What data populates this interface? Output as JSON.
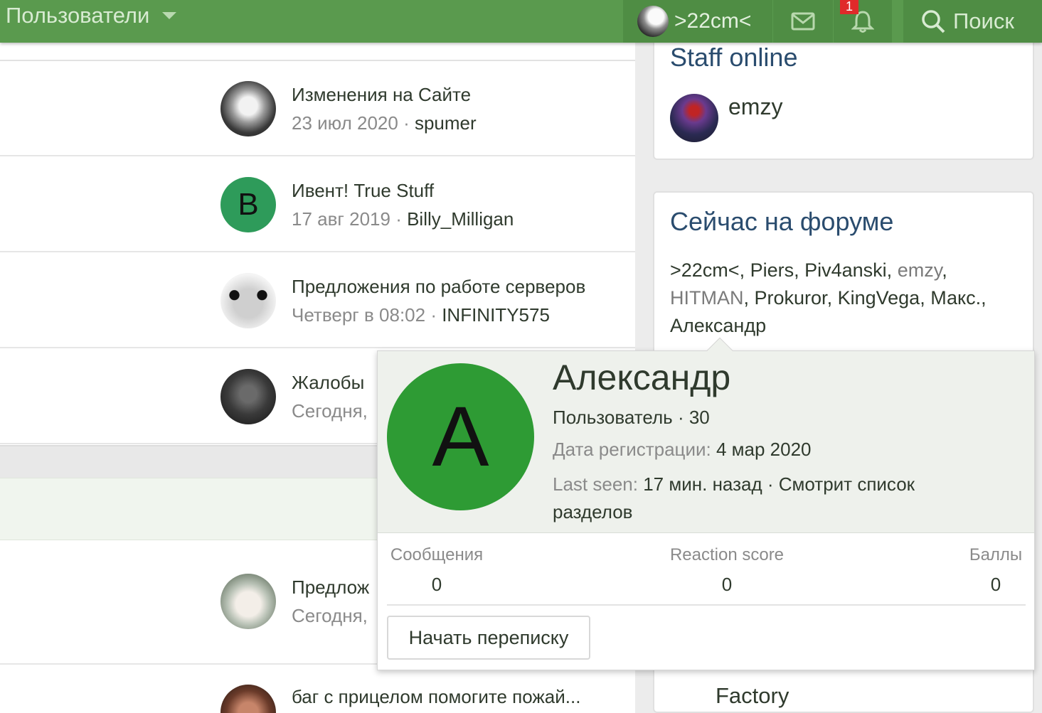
{
  "nav": {
    "users_label": "Пользователи",
    "account_name": ">22cm<",
    "notifications_count": "1",
    "search_label": "Поиск"
  },
  "threads": [
    {
      "title": "Изменения на Сайте",
      "date": "23 июл 2020",
      "user": "spumer"
    },
    {
      "title": "Ивент! True Stuff",
      "date": "17 авг 2019",
      "user": "Billy_Milligan",
      "avatar_letter": "B"
    },
    {
      "title": "Предложения по работе серверов",
      "date": "Четверг в 08:02",
      "user": "INFINITY575"
    },
    {
      "title": "Жалобы",
      "date": "Сегодня,"
    },
    {
      "title": "Предлож",
      "date": "Сегодня,"
    },
    {
      "title": "баг с прицелом помогите пожай..."
    }
  ],
  "staff_online": {
    "title": "Staff online",
    "members": [
      "emzy"
    ]
  },
  "now_on_forum": {
    "title": "Сейчас на форуме",
    "users": [
      ">22cm<",
      "Piers",
      "Piv4anski",
      "emzy",
      "HITMAN",
      "Prokuror",
      "KingVega",
      "Макс.",
      "Александр"
    ],
    "footer_text": "Factory"
  },
  "member_card": {
    "avatar_letter": "A",
    "username": "Александр",
    "role_line": "Пользователь · 30",
    "registered_label": "Дата регистрации:",
    "registered_value": "4 мар 2020",
    "last_seen_label": "Last seen:",
    "last_seen_value": "17 мин. назад · Смотрит список разделов",
    "stats": [
      {
        "label": "Сообщения",
        "value": "0"
      },
      {
        "label": "Reaction score",
        "value": "0"
      },
      {
        "label": "Баллы",
        "value": "0"
      }
    ],
    "start_conversation_label": "Начать переписку"
  },
  "colors": {
    "nav_green": "#5a9a4e",
    "nav_green_dark": "#4f8d44",
    "widget_title_blue": "#2a4c6e",
    "avatar_green": "#2e9b34",
    "badge_red": "#e02a2a"
  }
}
